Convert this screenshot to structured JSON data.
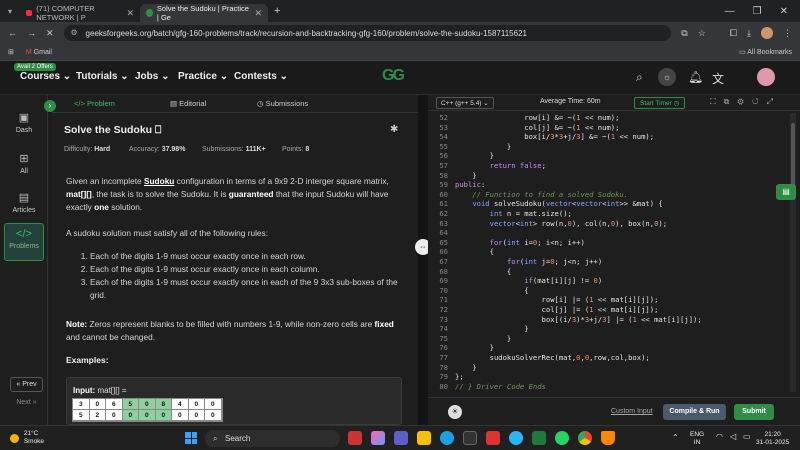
{
  "browser": {
    "tabs": [
      {
        "label": "(71) COMPUTER NETWORK | P",
        "active": false
      },
      {
        "label": "Solve the Sudoku | Practice | Ge",
        "active": true
      }
    ],
    "url": "geeksforgeeks.org/batch/gfg-160-problems/track/recursion-and-backtracking-gfg-160/problem/solve-the-sudoku-1587115621",
    "bookmarks": {
      "gmail": "Gmail",
      "all": "All Bookmarks"
    }
  },
  "gfg_nav": {
    "offers_badge": "Avail 2 Offers",
    "items": [
      "Courses",
      "Tutorials",
      "Jobs",
      "Practice",
      "Contests"
    ],
    "logo": "GG"
  },
  "sidebar": {
    "items": [
      {
        "label": "Dash"
      },
      {
        "label": "All"
      },
      {
        "label": "Articles"
      },
      {
        "label": "Problems"
      }
    ],
    "prev": "« Prev",
    "next": "Next »"
  },
  "problem": {
    "tabs": [
      "Problem",
      "Editorial",
      "Submissions"
    ],
    "title": "Solve the Sudoku",
    "difficulty_label": "Difficulty:",
    "difficulty": "Hard",
    "accuracy_label": "Accuracy:",
    "accuracy": "37.98%",
    "submissions_label": "Submissions:",
    "submissions": "111K+",
    "points_label": "Points:",
    "points": "8",
    "desc1_a": "Given an incomplete ",
    "desc1_b": "Sudoku",
    "desc1_c": " configuration in terms of a 9x9  2-D interger square matrix, ",
    "desc1_d": "mat[][]",
    "desc1_e": ", the task is to solve the Sudoku. It is ",
    "desc1_f": "guaranteed",
    "desc1_g": " that the input Sudoku will have exactly ",
    "desc1_h": "one",
    "desc1_i": " solution.",
    "desc2": "A sudoku solution must satisfy all of the following rules:",
    "rules": [
      "Each of the digits 1-9 must occur exactly once in each row.",
      "Each of the digits 1-9 must occur exactly once in each column.",
      "Each of the digits 1-9 must occur exactly once in each of the 9 3x3 sub-boxes of the grid."
    ],
    "note_label": "Note:",
    "note_a": " Zeros represent blanks to be filled with numbers 1-9, while non-zero cells are ",
    "note_b": "fixed",
    "note_c": " and cannot be changed.",
    "examples": "Examples:",
    "input_label": "Input:",
    "input_value": "mat[][] =",
    "grid_rows": [
      [
        "3",
        "0",
        "6",
        "5",
        "0",
        "8",
        "4",
        "0",
        "0"
      ],
      [
        "5",
        "2",
        "0",
        "0",
        "0",
        "0",
        "0",
        "0",
        "0"
      ]
    ]
  },
  "editor": {
    "language": "C++ (g++ 5.4)",
    "avg_time": "Average Time: 60m",
    "start_timer": "Start Timer",
    "lines": [
      {
        "n": "52",
        "t": "                row[i] &= ~(1 << num);"
      },
      {
        "n": "53",
        "t": "                col[j] &= ~(1 << num);"
      },
      {
        "n": "54",
        "t": "                box[i/3*3+j/3] &= ~(1 << num);"
      },
      {
        "n": "55",
        "t": "            }"
      },
      {
        "n": "56",
        "t": "        }"
      },
      {
        "n": "57",
        "t": "        return false;"
      },
      {
        "n": "58",
        "t": "    }"
      },
      {
        "n": "59",
        "t": "public:"
      },
      {
        "n": "60",
        "t": "    // Function to find a solved Sudoku."
      },
      {
        "n": "61",
        "t": "    void solveSudoku(vector<vector<int>> &mat) {"
      },
      {
        "n": "62",
        "t": "        int n = mat.size();"
      },
      {
        "n": "63",
        "t": "        vector<int> row(n,0), col(n,0), box(n,0);"
      },
      {
        "n": "64",
        "t": ""
      },
      {
        "n": "65",
        "t": "        for(int i=0; i<n; i++)"
      },
      {
        "n": "66",
        "t": "        {"
      },
      {
        "n": "67",
        "t": "            for(int j=0; j<n; j++)"
      },
      {
        "n": "68",
        "t": "            {"
      },
      {
        "n": "69",
        "t": "                if(mat[i][j] != 0)"
      },
      {
        "n": "70",
        "t": "                {"
      },
      {
        "n": "71",
        "t": "                    row[i] |= (1 << mat[i][j]);"
      },
      {
        "n": "72",
        "t": "                    col[j] |= (1 << mat[i][j]);"
      },
      {
        "n": "73",
        "t": "                    box[(i/3)*3+j/3] |= (1 << mat[i][j]);"
      },
      {
        "n": "74",
        "t": "                }"
      },
      {
        "n": "75",
        "t": "            }"
      },
      {
        "n": "76",
        "t": "        }"
      },
      {
        "n": "77",
        "t": "        sudokuSolverRec(mat,0,0,row,col,box);"
      },
      {
        "n": "78",
        "t": "    }"
      },
      {
        "n": "79",
        "t": "};"
      },
      {
        "n": "80",
        "t": "// } Driver Code Ends"
      }
    ],
    "custom_input": "Custom Input",
    "compile_run": "Compile & Run",
    "submit": "Submit"
  },
  "taskbar": {
    "temp": "21°C",
    "weather": "Smoke",
    "search": "Search",
    "lang1": "ENG",
    "lang2": "IN",
    "time": "21:20",
    "date": "31-01-2025"
  },
  "colors": {
    "accent": "#2f8d46",
    "bg": "#1e1e1e"
  }
}
